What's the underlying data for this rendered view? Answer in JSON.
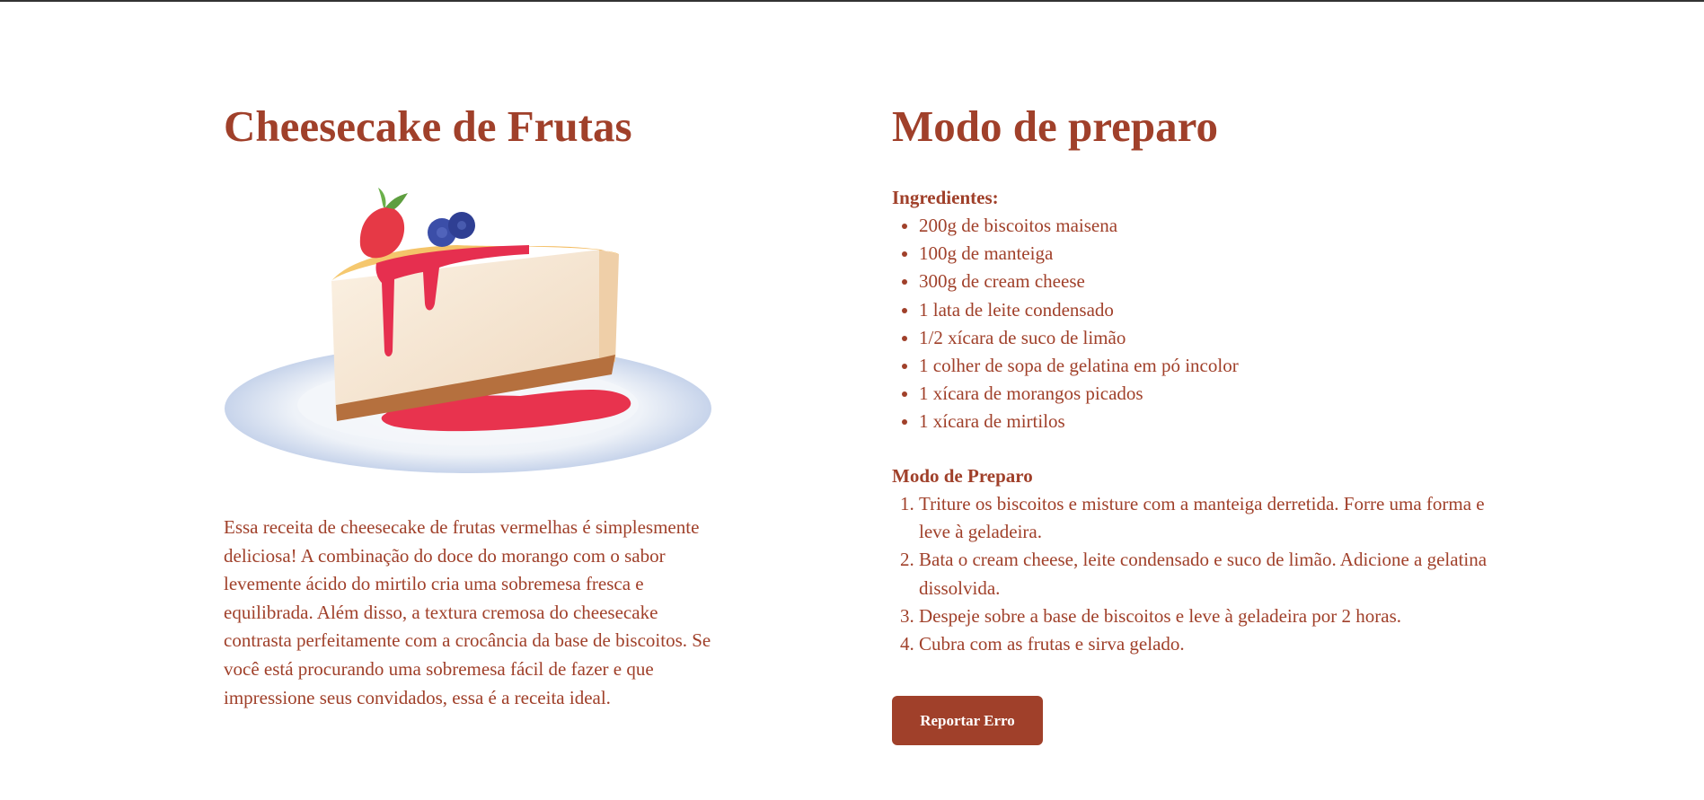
{
  "left": {
    "title": "Cheesecake de Frutas",
    "description": "Essa receita de cheesecake de frutas vermelhas é simplesmente deliciosa! A combinação do doce do morango com o sabor levemente ácido do mirtilo cria uma sobremesa fresca e equilibrada. Além disso, a textura cremosa do cheesecake contrasta perfeitamente com a crocância da base de biscoitos. Se você está procurando uma sobremesa fácil de fazer e que impressione seus convidados, essa é a receita ideal."
  },
  "right": {
    "title": "Modo de preparo",
    "ingredients_title": "Ingredientes:",
    "ingredients": [
      "200g de biscoitos maisena",
      "100g de manteiga",
      "300g de cream cheese",
      "1 lata de leite condensado",
      "1/2 xícara de suco de limão",
      "1 colher de sopa de gelatina em pó incolor",
      "1 xícara de morangos picados",
      "1 xícara de mirtilos"
    ],
    "steps_title": "Modo de Preparo",
    "steps": [
      "Triture os biscoitos e misture com a manteiga derretida. Forre uma forma e leve à geladeira.",
      "Bata o cream cheese, leite condensado e suco de limão. Adicione a gelatina dissolvida.",
      "Despeje sobre a base de biscoitos e leve à geladeira por 2 horas.",
      "Cubra com as frutas e sirva gelado."
    ],
    "report_button": "Reportar Erro"
  },
  "colors": {
    "accent": "#a0402a",
    "button_text": "#ffffff"
  }
}
